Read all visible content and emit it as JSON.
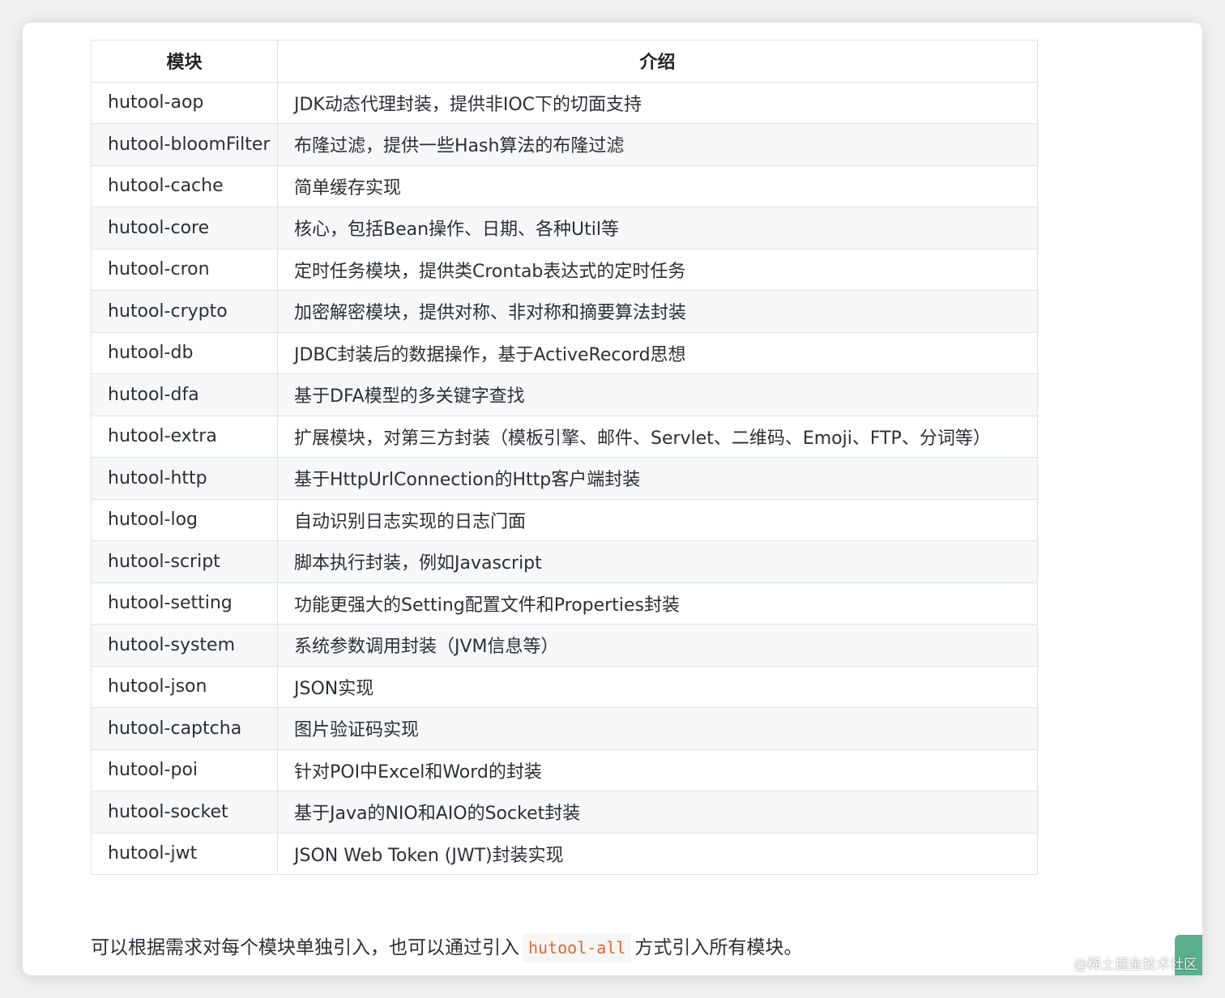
{
  "table": {
    "headers": [
      "模块",
      "介绍"
    ],
    "rows": [
      {
        "module": "hutool-aop",
        "desc": "JDK动态代理封装，提供非IOC下的切面支持"
      },
      {
        "module": "hutool-bloomFilter",
        "desc": "布隆过滤，提供一些Hash算法的布隆过滤"
      },
      {
        "module": "hutool-cache",
        "desc": "简单缓存实现"
      },
      {
        "module": "hutool-core",
        "desc": "核心，包括Bean操作、日期、各种Util等"
      },
      {
        "module": "hutool-cron",
        "desc": "定时任务模块，提供类Crontab表达式的定时任务"
      },
      {
        "module": "hutool-crypto",
        "desc": "加密解密模块，提供对称、非对称和摘要算法封装"
      },
      {
        "module": "hutool-db",
        "desc": "JDBC封装后的数据操作，基于ActiveRecord思想"
      },
      {
        "module": "hutool-dfa",
        "desc": "基于DFA模型的多关键字查找"
      },
      {
        "module": "hutool-extra",
        "desc": "扩展模块，对第三方封装（模板引擎、邮件、Servlet、二维码、Emoji、FTP、分词等）"
      },
      {
        "module": "hutool-http",
        "desc": "基于HttpUrlConnection的Http客户端封装"
      },
      {
        "module": "hutool-log",
        "desc": "自动识别日志实现的日志门面"
      },
      {
        "module": "hutool-script",
        "desc": "脚本执行封装，例如Javascript"
      },
      {
        "module": "hutool-setting",
        "desc": "功能更强大的Setting配置文件和Properties封装"
      },
      {
        "module": "hutool-system",
        "desc": "系统参数调用封装（JVM信息等）"
      },
      {
        "module": "hutool-json",
        "desc": "JSON实现"
      },
      {
        "module": "hutool-captcha",
        "desc": "图片验证码实现"
      },
      {
        "module": "hutool-poi",
        "desc": "针对POI中Excel和Word的封装"
      },
      {
        "module": "hutool-socket",
        "desc": "基于Java的NIO和AIO的Socket封装"
      },
      {
        "module": "hutool-jwt",
        "desc": "JSON Web Token (JWT)封装实现"
      }
    ]
  },
  "footer": {
    "before": "可以根据需求对每个模块单独引入，也可以通过引入",
    "code": "hutool-all",
    "after": "方式引入所有模块。"
  },
  "watermark": "@稀土掘金技术社区",
  "colors": {
    "code_text": "#e2682f",
    "stripe": "#f6f8fa",
    "border": "#dfe2e5",
    "corner_tab": "#5aaf8c"
  }
}
